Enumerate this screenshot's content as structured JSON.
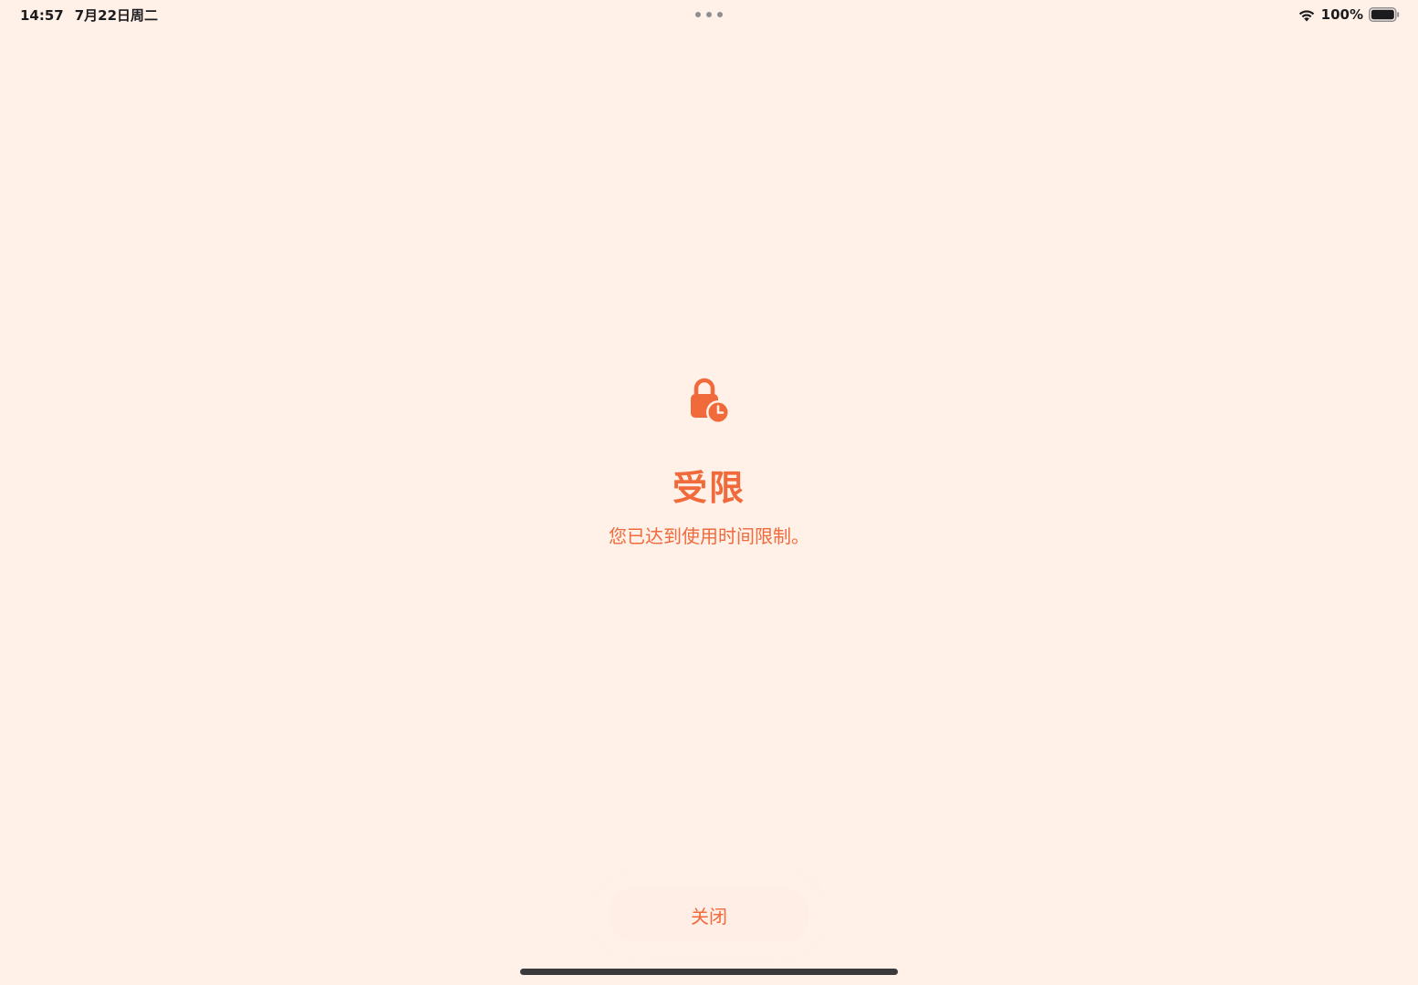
{
  "status_bar": {
    "time": "14:57",
    "date": "7月22日周二",
    "battery_percent": "100%",
    "icons": [
      "wifi-icon",
      "battery-icon"
    ],
    "multitask_icon": "more-dots-icon"
  },
  "screen": {
    "icon": "lock-clock-icon",
    "title": "受限",
    "message": "您已达到使用时间限制。"
  },
  "actions": {
    "close_label": "关闭"
  },
  "colors": {
    "background": "#fff0e8",
    "accent": "#f06a3b",
    "status_text": "#1c1c1e"
  }
}
